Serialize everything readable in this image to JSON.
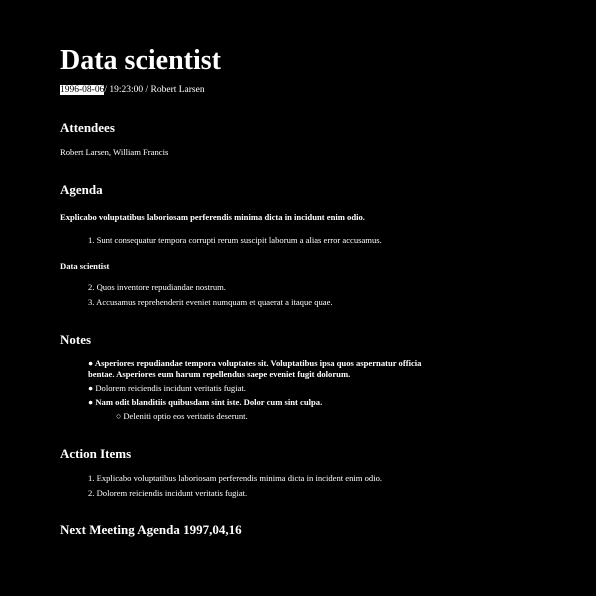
{
  "document": {
    "title": "Data scientist",
    "meta": {
      "date": "1996-08-06",
      "rest": "/ 19:23:00 / Robert Larsen"
    }
  },
  "attendees": {
    "heading": "Attendees",
    "names": "Robert Larsen, William Francis"
  },
  "agenda": {
    "heading": "Agenda",
    "topic1": "Explicabo voluptatibus laboriosam perferendis minima dicta in incidunt enim odio.",
    "items1": [
      "1. Sunt consequatur tempora corrupti rerum suscipit laborum a alias error accusamus."
    ],
    "topic2": "Data scientist",
    "items2": [
      "2. Quos inventore repudiandae nostrum.",
      "3. Accusamus reprehenderit eveniet numquam et quaerat a itaque quae."
    ]
  },
  "notes": {
    "heading": "Notes",
    "items": [
      "● Asperiores repudiandae tempora voluptates sit. Voluptatibus ipsa quos aspernatur officia bentae. Asperiores eum harum repellendus saepe eveniet fugit dolorum.",
      "● Dolorem reiciendis incidunt veritatis fugiat.",
      "● Nam odit blanditiis quibusdam sint iste. Dolor cum sint culpa."
    ],
    "subitems": [
      "○ Deleniti optio eos veritatis deserunt."
    ]
  },
  "action_items": {
    "heading": "Action Items",
    "items": [
      "1. Explicabo voluptatibus laboriosam perferendis minima dicta in incident enim odio.",
      "2. Dolorem reiciendis incidunt veritatis fugiat."
    ]
  },
  "next_meeting": {
    "heading": "Next Meeting Agenda 1997,04,16"
  }
}
